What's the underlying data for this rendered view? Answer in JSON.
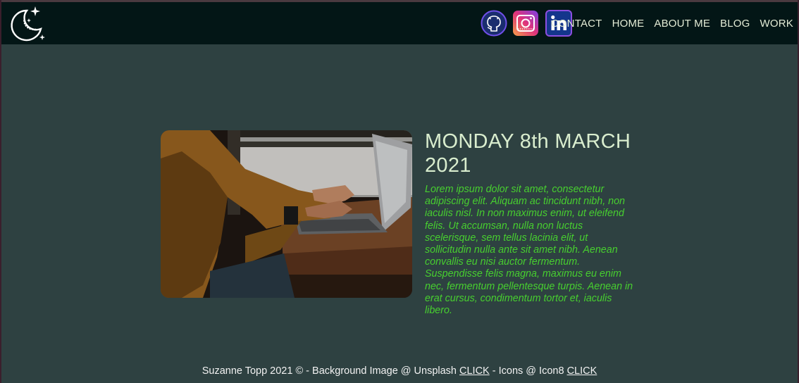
{
  "header": {
    "logo_icon": "moon-stars-icon",
    "social": [
      {
        "name": "github-icon",
        "border": "#6f4fe8"
      },
      {
        "name": "instagram-icon",
        "gradient": [
          "#f6a04a",
          "#e0337a",
          "#7b3fe4"
        ]
      },
      {
        "name": "linkedin-icon",
        "border": "#8d4fe0",
        "fill": "#1b63c9"
      }
    ],
    "nav": {
      "contact": "CONTACT",
      "home": "HOME",
      "about": "ABOUT ME",
      "blog": "BLOG",
      "work": "WORK"
    }
  },
  "post": {
    "title": "MONDAY 8th MARCH 2021",
    "body": "Lorem ipsum dolor sit amet, consectetur adipiscing elit. Aliquam ac tincidunt nibh, non iaculis nisl. In non maximus enim, ut eleifend felis. Ut accumsan, nulla non luctus scelerisque, sem tellus lacinia elit, ut sollicitudin nulla ante sit amet nibh. Aenean convallis eu nisi auctor fermentum. Suspendisse felis magna, maximus eu enim nec, fermentum pellentesque turpis. Aenean in erat cursus, condimentum tortor et, iaculis libero.",
    "image": "laptop-typing-photo"
  },
  "footer": {
    "credit_prefix": "Suzanne Topp 2021 © - Background Image @ Unsplash",
    "link1": "CLICK",
    "middle": "- Icons @ Icon8",
    "link2": "CLICK"
  },
  "colors": {
    "background": "#2e4141",
    "header_bg": "#031616",
    "title": "#d9edce",
    "body_text": "#47cf2f",
    "nav_text": "#e4ecd6"
  }
}
